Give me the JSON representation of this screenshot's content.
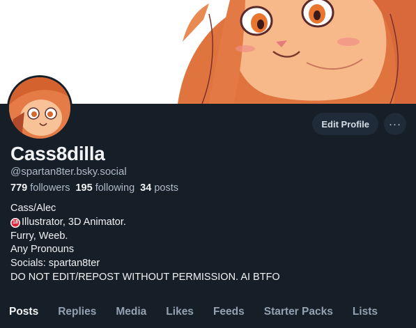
{
  "profile": {
    "display_name": "Cass8dilla",
    "handle": "@spartan8ter.bsky.social",
    "stats": {
      "followers_count": "779",
      "followers_label": "followers",
      "following_count": "195",
      "following_label": "following",
      "posts_count": "34",
      "posts_label": "posts"
    },
    "bio": {
      "line1": "Cass/Alec",
      "line2_badge": "18",
      "line2": "Illustrator, 3D Animator.",
      "line3": "Furry, Weeb.",
      "line4": "Any Pronouns",
      "line5": "Socials: spartan8ter",
      "line6": "DO NOT EDIT/REPOST WITHOUT PERMISSION. AI BTFO"
    }
  },
  "actions": {
    "edit_label": "Edit Profile",
    "more_label": "···"
  },
  "tabs": [
    {
      "label": "Posts",
      "active": true
    },
    {
      "label": "Replies",
      "active": false
    },
    {
      "label": "Media",
      "active": false
    },
    {
      "label": "Likes",
      "active": false
    },
    {
      "label": "Feeds",
      "active": false
    },
    {
      "label": "Starter Packs",
      "active": false
    },
    {
      "label": "Lists",
      "active": false
    }
  ],
  "colors": {
    "background": "#161e27",
    "button_bg": "#1f2b38",
    "muted_text": "#aebbc9",
    "badge_red": "#e0253a",
    "artwork_skin": "#f7b98a",
    "artwork_hair": "#e0743f"
  }
}
